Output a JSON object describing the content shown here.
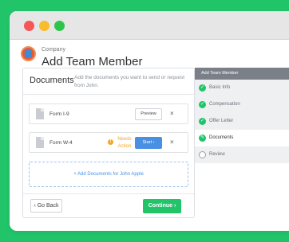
{
  "colors": {
    "background": "#22c46a",
    "accent_blue": "#4a90e2",
    "warning": "#f5a623",
    "success": "#22c46a"
  },
  "header": {
    "company": "Company",
    "title": "Add Team Member"
  },
  "documents": {
    "title": "Documents",
    "description": "Add the documents you want to send or request from John.",
    "rows": [
      {
        "name": "Form I-9",
        "action": "Preview",
        "remove": "×"
      },
      {
        "name": "Form W-4",
        "status": "Needs Action",
        "action": "Start ›",
        "remove": "×"
      }
    ],
    "add_label": "+ Add Documents for John Apple"
  },
  "footer": {
    "back_label": "‹  Go Back",
    "continue_label": "Continue  ›"
  },
  "steps": {
    "title": "Add Team Member",
    "items": [
      {
        "label": "Basic Info",
        "state": "done",
        "icon": "check-icon"
      },
      {
        "label": "Compensation",
        "state": "done",
        "icon": "check-icon"
      },
      {
        "label": "Offer Letter",
        "state": "done",
        "icon": "check-icon"
      },
      {
        "label": "Documents",
        "state": "current",
        "icon": "pencil-icon"
      },
      {
        "label": "Review",
        "state": "todo",
        "icon": "empty-circle-icon"
      }
    ]
  }
}
